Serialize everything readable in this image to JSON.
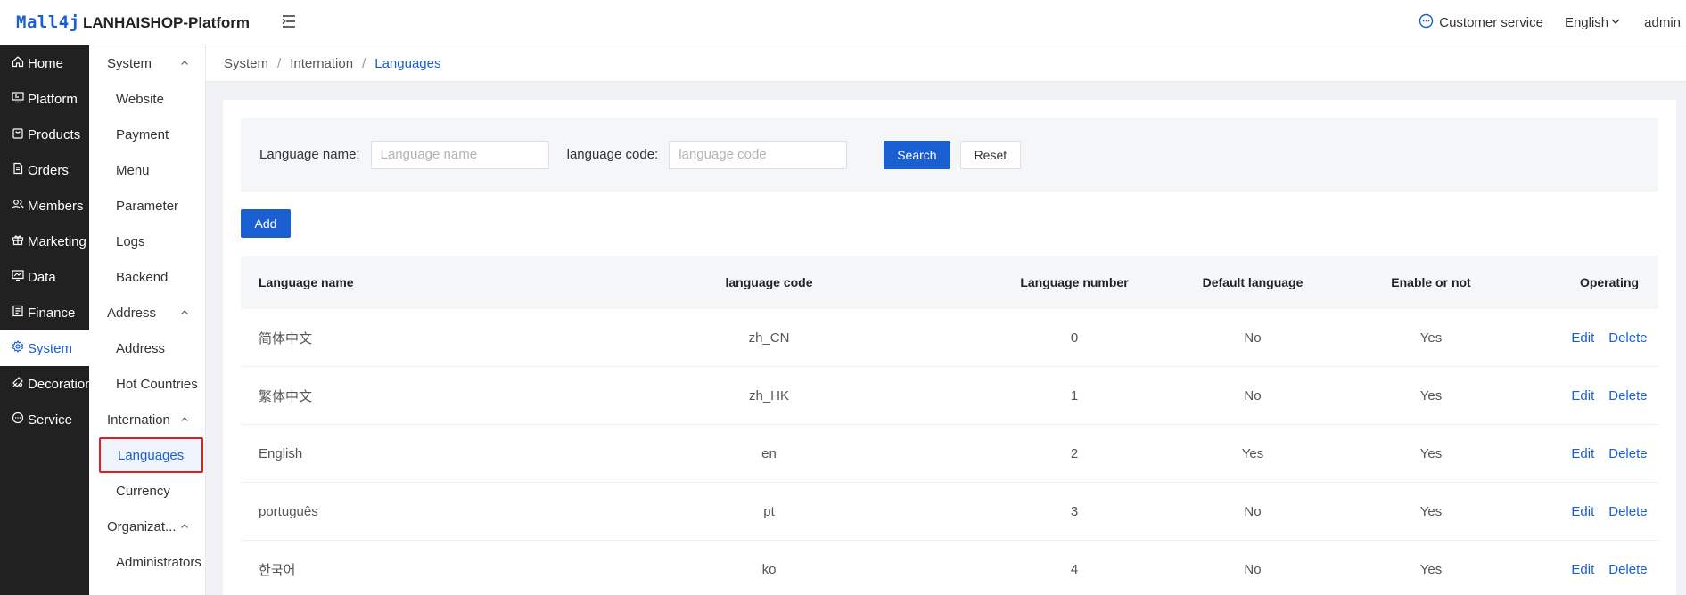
{
  "header": {
    "logo_text": "Mall4j",
    "platform_name": "LANHAISHOP-Platform",
    "customer_service": "Customer service",
    "language": "English",
    "user": "admin"
  },
  "sidebar": {
    "items": [
      {
        "label": "Home",
        "icon": "home-icon"
      },
      {
        "label": "Platform",
        "icon": "monitor-icon"
      },
      {
        "label": "Products",
        "icon": "bag-icon"
      },
      {
        "label": "Orders",
        "icon": "document-icon"
      },
      {
        "label": "Members",
        "icon": "users-icon"
      },
      {
        "label": "Marketing",
        "icon": "gift-icon"
      },
      {
        "label": "Data",
        "icon": "chart-icon"
      },
      {
        "label": "Finance",
        "icon": "ledger-icon"
      },
      {
        "label": "System",
        "icon": "gear-icon"
      },
      {
        "label": "Decoration",
        "icon": "palette-icon"
      },
      {
        "label": "Service",
        "icon": "chat-icon"
      }
    ]
  },
  "submenu": {
    "groups": [
      {
        "label": "System",
        "items": [
          "Website",
          "Payment",
          "Menu",
          "Parameter",
          "Logs",
          "Backend"
        ]
      },
      {
        "label": "Address",
        "items": [
          "Address",
          "Hot Countries"
        ]
      },
      {
        "label": "Internation",
        "items": [
          "Languages",
          "Currency"
        ]
      },
      {
        "label": "Organizat...",
        "items": [
          "Administrators"
        ]
      }
    ]
  },
  "breadcrumb": {
    "items": [
      "System",
      "Internation"
    ],
    "current": "Languages",
    "separator": "/"
  },
  "search": {
    "name_label": "Language name:",
    "name_placeholder": "Language name",
    "code_label": "language code:",
    "code_placeholder": "language code",
    "search_label": "Search",
    "reset_label": "Reset"
  },
  "add_label": "Add",
  "table": {
    "columns": [
      "Language name",
      "language code",
      "Language number",
      "Default language",
      "Enable or not",
      "Operating"
    ],
    "rows": [
      {
        "name": "简体中文",
        "code": "zh_CN",
        "number": "0",
        "default": "No",
        "enabled": "Yes"
      },
      {
        "name": "繁体中文",
        "code": "zh_HK",
        "number": "1",
        "default": "No",
        "enabled": "Yes"
      },
      {
        "name": "English",
        "code": "en",
        "number": "2",
        "default": "Yes",
        "enabled": "Yes"
      },
      {
        "name": "português",
        "code": "pt",
        "number": "3",
        "default": "No",
        "enabled": "Yes"
      },
      {
        "name": "한국어",
        "code": "ko",
        "number": "4",
        "default": "No",
        "enabled": "Yes"
      }
    ],
    "edit_label": "Edit",
    "delete_label": "Delete"
  },
  "colors": {
    "accent": "#1a5fd1",
    "sidebar_bg": "#212121",
    "highlight_border": "#e02020"
  }
}
